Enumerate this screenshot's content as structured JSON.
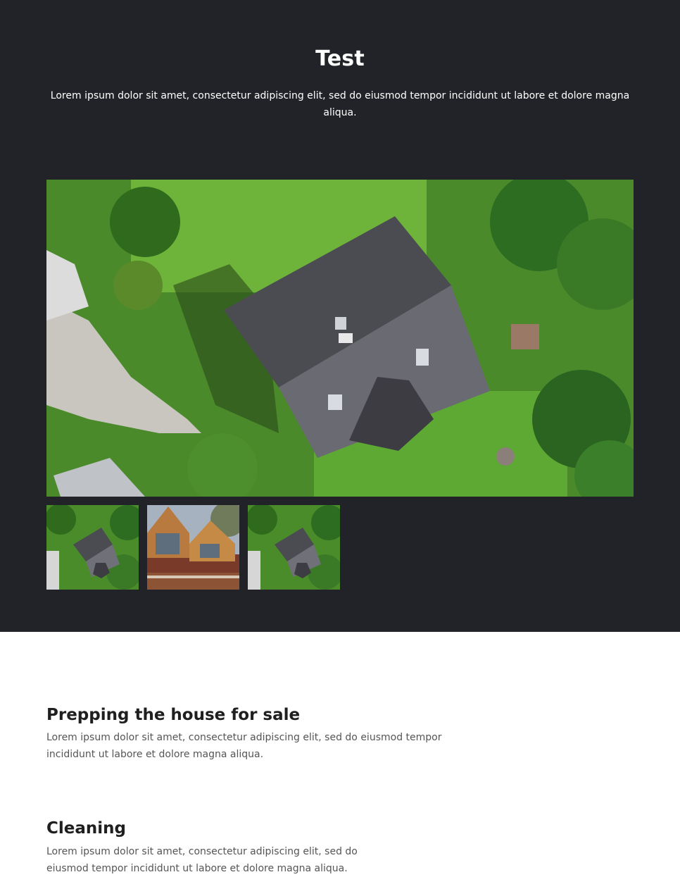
{
  "hero": {
    "title": "Test",
    "description": "Lorem ipsum dolor sit amet, consectetur adipiscing elit, sed do eiusmod tempor incididunt ut labore et dolore magna aliqua.",
    "background": "#212328"
  },
  "gallery": {
    "main_image": "aerial-house-photo",
    "thumbnails": [
      {
        "image": "aerial-house-photo"
      },
      {
        "image": "house-dormers-photo"
      },
      {
        "image": "aerial-house-photo"
      }
    ]
  },
  "sections": [
    {
      "title": "Prepping the house for sale",
      "body": "Lorem ipsum dolor sit amet, consectetur adipiscing elit, sed do eiusmod tempor incididunt ut labore et dolore magna aliqua."
    },
    {
      "title": "Cleaning",
      "body": "Lorem ipsum dolor sit amet, consectetur adipiscing elit, sed do eiusmod tempor incididunt ut labore et dolore magna aliqua."
    }
  ]
}
